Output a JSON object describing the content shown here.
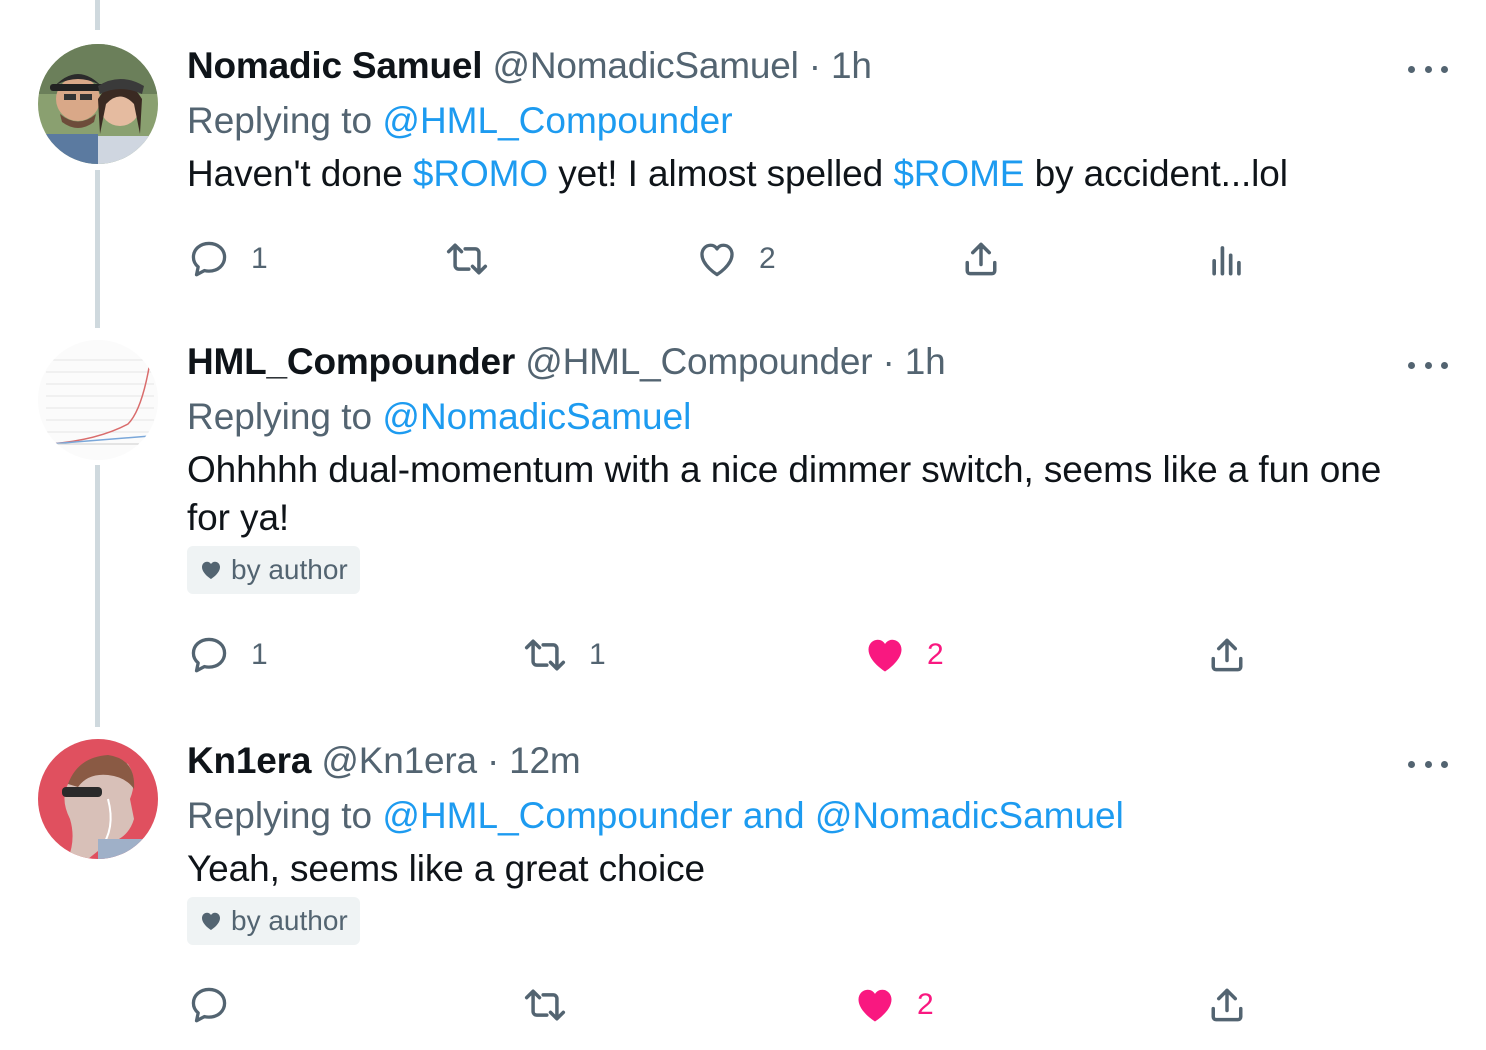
{
  "tweets": [
    {
      "name": "Nomadic Samuel",
      "handle": "@NomadicSamuel",
      "separator": "·",
      "time": "1h",
      "replying_prefix": "Replying to",
      "replying_targets": "@HML_Compounder",
      "text": {
        "t1": "Haven't done ",
        "cash1": "$ROMO",
        "t2": " yet! I almost spelled ",
        "cash2": "$ROME",
        "t3": " by accident...lol"
      },
      "actions": {
        "reply_count": "1",
        "retweet_count": "",
        "like_count": "2",
        "liked": false
      }
    },
    {
      "name": "HML_Compounder",
      "handle": "@HML_Compounder",
      "separator": "·",
      "time": "1h",
      "replying_prefix": "Replying to",
      "replying_targets": "@NomadicSamuel",
      "text": "Ohhhhh dual-momentum with a nice dimmer switch, seems like a fun one for ya!",
      "badge": "by author",
      "actions": {
        "reply_count": "1",
        "retweet_count": "1",
        "like_count": "2",
        "liked": true
      }
    },
    {
      "name": "Kn1era",
      "handle": "@Kn1era",
      "separator": "·",
      "time": "12m",
      "replying_prefix": "Replying to",
      "replying_targets": "@HML_Compounder and @NomadicSamuel",
      "text": "Yeah, seems like a great choice",
      "badge": "by author",
      "actions": {
        "reply_count": "",
        "retweet_count": "",
        "like_count": "2",
        "liked": true
      }
    }
  ],
  "icons": {
    "reply": "reply-bubble-icon",
    "retweet": "retweet-arrows-icon",
    "like": "heart-icon",
    "share": "share-upload-icon",
    "analytics": "bar-chart-icon",
    "more": "more-dots-icon"
  },
  "colors": {
    "link": "#1d9bf0",
    "muted": "#536471",
    "like": "#f91880",
    "thread_line": "#cfd9de",
    "badge_bg": "#eff3f4"
  }
}
